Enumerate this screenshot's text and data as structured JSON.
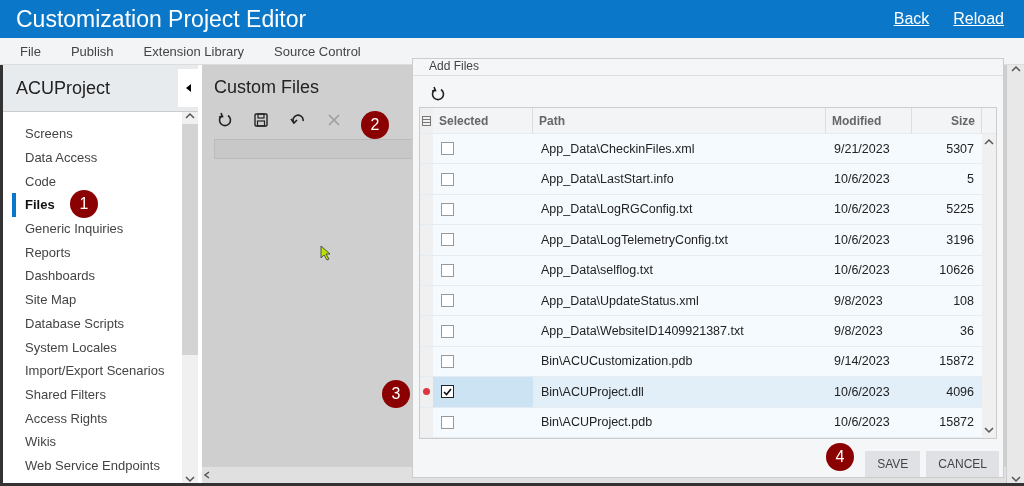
{
  "header": {
    "title": "Customization Project Editor",
    "links": [
      "Back",
      "Reload"
    ]
  },
  "menu": [
    "File",
    "Publish",
    "Extension Library",
    "Source Control"
  ],
  "sidebar": {
    "title": "ACUProject",
    "items": [
      {
        "label": "Screens",
        "selected": false
      },
      {
        "label": "Data Access",
        "selected": false
      },
      {
        "label": "Code",
        "selected": false
      },
      {
        "label": "Files",
        "selected": true
      },
      {
        "label": "Generic Inquiries",
        "selected": false
      },
      {
        "label": "Reports",
        "selected": false
      },
      {
        "label": "Dashboards",
        "selected": false
      },
      {
        "label": "Site Map",
        "selected": false
      },
      {
        "label": "Database Scripts",
        "selected": false
      },
      {
        "label": "System Locales",
        "selected": false
      },
      {
        "label": "Import/Export Scenarios",
        "selected": false
      },
      {
        "label": "Shared Filters",
        "selected": false
      },
      {
        "label": "Access Rights",
        "selected": false
      },
      {
        "label": "Wikis",
        "selected": false
      },
      {
        "label": "Web Service Endpoints",
        "selected": false
      }
    ]
  },
  "panel": {
    "title": "Custom Files"
  },
  "dialog": {
    "title": "Add Files",
    "columns": [
      "Selected",
      "Path",
      "Modified",
      "Size"
    ],
    "rows": [
      {
        "checked": false,
        "path": "App_Data\\CheckinFiles.xml",
        "modified": "9/21/2023",
        "size": "5307"
      },
      {
        "checked": false,
        "path": "App_Data\\LastStart.info",
        "modified": "10/6/2023",
        "size": "5"
      },
      {
        "checked": false,
        "path": "App_Data\\LogRGConfig.txt",
        "modified": "10/6/2023",
        "size": "5225"
      },
      {
        "checked": false,
        "path": "App_Data\\LogTelemetryConfig.txt",
        "modified": "10/6/2023",
        "size": "3196"
      },
      {
        "checked": false,
        "path": "App_Data\\selflog.txt",
        "modified": "10/6/2023",
        "size": "10626"
      },
      {
        "checked": false,
        "path": "App_Data\\UpdateStatus.xml",
        "modified": "9/8/2023",
        "size": "108"
      },
      {
        "checked": false,
        "path": "App_Data\\WebsiteID1409921387.txt",
        "modified": "9/8/2023",
        "size": "36"
      },
      {
        "checked": false,
        "path": "Bin\\ACUCustomization.pdb",
        "modified": "9/14/2023",
        "size": "15872"
      },
      {
        "checked": true,
        "path": "Bin\\ACUProject.dll",
        "modified": "10/6/2023",
        "size": "4096"
      },
      {
        "checked": false,
        "path": "Bin\\ACUProject.pdb",
        "modified": "10/6/2023",
        "size": "15872"
      }
    ],
    "buttons": [
      "SAVE",
      "CANCEL"
    ]
  },
  "callouts": [
    "1",
    "2",
    "3",
    "4"
  ]
}
